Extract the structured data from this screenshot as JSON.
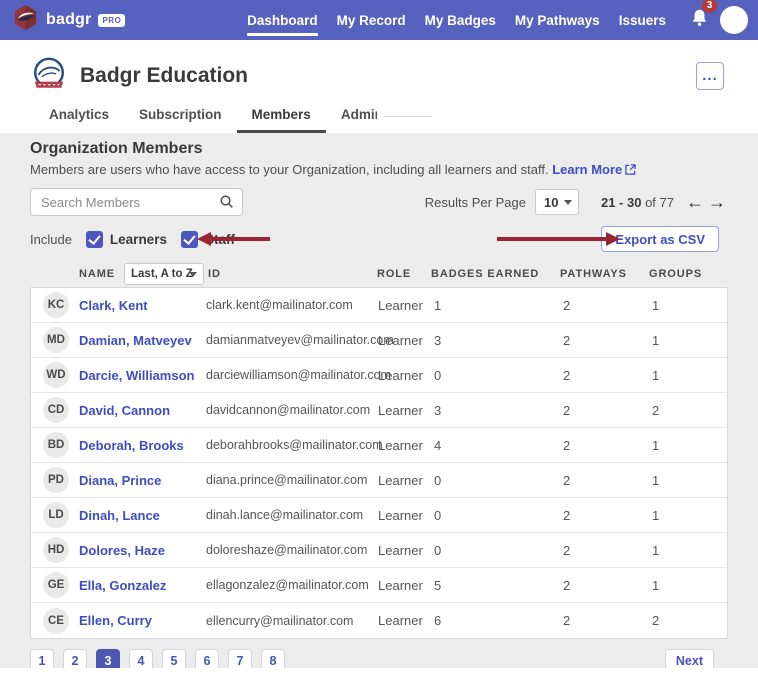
{
  "colors": {
    "nav_bg": "#5761BE",
    "accent_blue": "#3D4DC3",
    "annotation_red": "#992432",
    "notification_badge_red": "#B23B36",
    "active_page_bg": "#4C57B2",
    "page_bg": "#ECECEC",
    "tab_underline": "#4A4A4A"
  },
  "nav": {
    "brand": "badgr",
    "brand_badge": "PRO",
    "items": [
      {
        "label": "Dashboard",
        "active": true
      },
      {
        "label": "My Record",
        "active": false
      },
      {
        "label": "My Badges",
        "active": false
      },
      {
        "label": "My Pathways",
        "active": false
      },
      {
        "label": "Issuers",
        "active": false
      }
    ],
    "notification_count": "3"
  },
  "header": {
    "org_name": "Badgr Education",
    "menu_button": "...",
    "tabs": [
      {
        "label": "Analytics",
        "active": false
      },
      {
        "label": "Subscription",
        "active": false
      },
      {
        "label": "Members",
        "active": true
      },
      {
        "label": "Admins",
        "active": false
      }
    ]
  },
  "page": {
    "heading": "Organization Members",
    "description": "Members are users who have access to your Organization, including all learners and staff.",
    "learn_more": "Learn More"
  },
  "toolbar": {
    "search_placeholder": "Search Members",
    "results_per_page_label": "Results Per Page",
    "per_page": "10",
    "range": "21 - 30",
    "range_total": "of 77",
    "pager_prev_icon": "←",
    "pager_next_icon": "→"
  },
  "filters": {
    "include_label": "Include",
    "options": [
      {
        "label": "Learners",
        "checked": true
      },
      {
        "label": "Staff",
        "checked": true
      }
    ],
    "export_label": "Export as CSV"
  },
  "table": {
    "sort_value": "Last, A to Z",
    "headers": {
      "name": "NAME",
      "id": "ID",
      "role": "ROLE",
      "badges": "BADGES EARNED",
      "pathways": "PATHWAYS",
      "groups": "GROUPS"
    },
    "rows": [
      {
        "initials": "KC",
        "name": "Clark, Kent",
        "id": "clark.kent@mailinator.com",
        "role": "Learner",
        "badges": "1",
        "pathways": "2",
        "groups": "1"
      },
      {
        "initials": "MD",
        "name": "Damian, Matveyev",
        "id": "damianmatveyev@mailinator.com",
        "role": "Learner",
        "badges": "3",
        "pathways": "2",
        "groups": "1"
      },
      {
        "initials": "WD",
        "name": "Darcie, Williamson",
        "id": "darciewilliamson@mailinator.com",
        "role": "Learner",
        "badges": "0",
        "pathways": "2",
        "groups": "1"
      },
      {
        "initials": "CD",
        "name": "David, Cannon",
        "id": "davidcannon@mailinator.com",
        "role": "Learner",
        "badges": "3",
        "pathways": "2",
        "groups": "2"
      },
      {
        "initials": "BD",
        "name": "Deborah, Brooks",
        "id": "deborahbrooks@mailinator.com",
        "role": "Learner",
        "badges": "4",
        "pathways": "2",
        "groups": "1"
      },
      {
        "initials": "PD",
        "name": "Diana, Prince",
        "id": "diana.prince@mailinator.com",
        "role": "Learner",
        "badges": "0",
        "pathways": "2",
        "groups": "1"
      },
      {
        "initials": "LD",
        "name": "Dinah, Lance",
        "id": "dinah.lance@mailinator.com",
        "role": "Learner",
        "badges": "0",
        "pathways": "2",
        "groups": "1"
      },
      {
        "initials": "HD",
        "name": "Dolores, Haze",
        "id": "doloreshaze@mailinator.com",
        "role": "Learner",
        "badges": "0",
        "pathways": "2",
        "groups": "1"
      },
      {
        "initials": "GE",
        "name": "Ella, Gonzalez",
        "id": "ellagonzalez@mailinator.com",
        "role": "Learner",
        "badges": "5",
        "pathways": "2",
        "groups": "1"
      },
      {
        "initials": "CE",
        "name": "Ellen, Curry",
        "id": "ellencurry@mailinator.com",
        "role": "Learner",
        "badges": "6",
        "pathways": "2",
        "groups": "2"
      }
    ]
  },
  "pagination": {
    "pages": [
      "1",
      "2",
      "3",
      "4",
      "5",
      "6",
      "7",
      "8"
    ],
    "active_page": "3",
    "next_label": "Next"
  }
}
